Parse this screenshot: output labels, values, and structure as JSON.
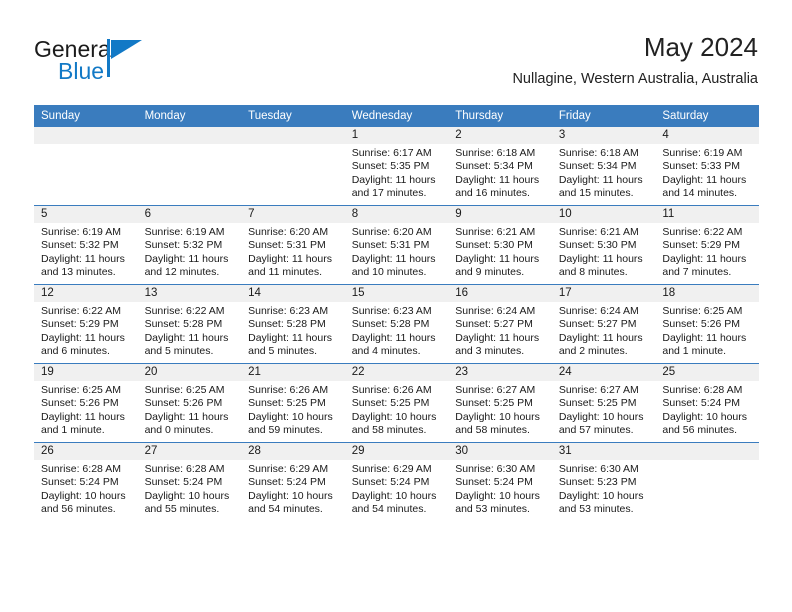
{
  "brand": {
    "name_top": "General",
    "name_bottom": "Blue",
    "accent_color": "#1279c6",
    "logo_icon": "triangle-flag-icon"
  },
  "header": {
    "title": "May 2024",
    "subtitle": "Nullagine, Western Australia, Australia"
  },
  "theme": {
    "header_bg": "#3a7cbe",
    "header_text": "#ffffff",
    "date_strip_bg": "#f0f0f0",
    "cell_bg": "#ffffff",
    "text": "#1a1a1a"
  },
  "calendar": {
    "columns": [
      "Sunday",
      "Monday",
      "Tuesday",
      "Wednesday",
      "Thursday",
      "Friday",
      "Saturday"
    ],
    "weeks": [
      [
        {
          "day": "",
          "lines": []
        },
        {
          "day": "",
          "lines": []
        },
        {
          "day": "",
          "lines": []
        },
        {
          "day": "1",
          "lines": [
            "Sunrise: 6:17 AM",
            "Sunset: 5:35 PM",
            "Daylight: 11 hours",
            "and 17 minutes."
          ]
        },
        {
          "day": "2",
          "lines": [
            "Sunrise: 6:18 AM",
            "Sunset: 5:34 PM",
            "Daylight: 11 hours",
            "and 16 minutes."
          ]
        },
        {
          "day": "3",
          "lines": [
            "Sunrise: 6:18 AM",
            "Sunset: 5:34 PM",
            "Daylight: 11 hours",
            "and 15 minutes."
          ]
        },
        {
          "day": "4",
          "lines": [
            "Sunrise: 6:19 AM",
            "Sunset: 5:33 PM",
            "Daylight: 11 hours",
            "and 14 minutes."
          ]
        }
      ],
      [
        {
          "day": "5",
          "lines": [
            "Sunrise: 6:19 AM",
            "Sunset: 5:32 PM",
            "Daylight: 11 hours",
            "and 13 minutes."
          ]
        },
        {
          "day": "6",
          "lines": [
            "Sunrise: 6:19 AM",
            "Sunset: 5:32 PM",
            "Daylight: 11 hours",
            "and 12 minutes."
          ]
        },
        {
          "day": "7",
          "lines": [
            "Sunrise: 6:20 AM",
            "Sunset: 5:31 PM",
            "Daylight: 11 hours",
            "and 11 minutes."
          ]
        },
        {
          "day": "8",
          "lines": [
            "Sunrise: 6:20 AM",
            "Sunset: 5:31 PM",
            "Daylight: 11 hours",
            "and 10 minutes."
          ]
        },
        {
          "day": "9",
          "lines": [
            "Sunrise: 6:21 AM",
            "Sunset: 5:30 PM",
            "Daylight: 11 hours",
            "and 9 minutes."
          ]
        },
        {
          "day": "10",
          "lines": [
            "Sunrise: 6:21 AM",
            "Sunset: 5:30 PM",
            "Daylight: 11 hours",
            "and 8 minutes."
          ]
        },
        {
          "day": "11",
          "lines": [
            "Sunrise: 6:22 AM",
            "Sunset: 5:29 PM",
            "Daylight: 11 hours",
            "and 7 minutes."
          ]
        }
      ],
      [
        {
          "day": "12",
          "lines": [
            "Sunrise: 6:22 AM",
            "Sunset: 5:29 PM",
            "Daylight: 11 hours",
            "and 6 minutes."
          ]
        },
        {
          "day": "13",
          "lines": [
            "Sunrise: 6:22 AM",
            "Sunset: 5:28 PM",
            "Daylight: 11 hours",
            "and 5 minutes."
          ]
        },
        {
          "day": "14",
          "lines": [
            "Sunrise: 6:23 AM",
            "Sunset: 5:28 PM",
            "Daylight: 11 hours",
            "and 5 minutes."
          ]
        },
        {
          "day": "15",
          "lines": [
            "Sunrise: 6:23 AM",
            "Sunset: 5:28 PM",
            "Daylight: 11 hours",
            "and 4 minutes."
          ]
        },
        {
          "day": "16",
          "lines": [
            "Sunrise: 6:24 AM",
            "Sunset: 5:27 PM",
            "Daylight: 11 hours",
            "and 3 minutes."
          ]
        },
        {
          "day": "17",
          "lines": [
            "Sunrise: 6:24 AM",
            "Sunset: 5:27 PM",
            "Daylight: 11 hours",
            "and 2 minutes."
          ]
        },
        {
          "day": "18",
          "lines": [
            "Sunrise: 6:25 AM",
            "Sunset: 5:26 PM",
            "Daylight: 11 hours",
            "and 1 minute."
          ]
        }
      ],
      [
        {
          "day": "19",
          "lines": [
            "Sunrise: 6:25 AM",
            "Sunset: 5:26 PM",
            "Daylight: 11 hours",
            "and 1 minute."
          ]
        },
        {
          "day": "20",
          "lines": [
            "Sunrise: 6:25 AM",
            "Sunset: 5:26 PM",
            "Daylight: 11 hours",
            "and 0 minutes."
          ]
        },
        {
          "day": "21",
          "lines": [
            "Sunrise: 6:26 AM",
            "Sunset: 5:25 PM",
            "Daylight: 10 hours",
            "and 59 minutes."
          ]
        },
        {
          "day": "22",
          "lines": [
            "Sunrise: 6:26 AM",
            "Sunset: 5:25 PM",
            "Daylight: 10 hours",
            "and 58 minutes."
          ]
        },
        {
          "day": "23",
          "lines": [
            "Sunrise: 6:27 AM",
            "Sunset: 5:25 PM",
            "Daylight: 10 hours",
            "and 58 minutes."
          ]
        },
        {
          "day": "24",
          "lines": [
            "Sunrise: 6:27 AM",
            "Sunset: 5:25 PM",
            "Daylight: 10 hours",
            "and 57 minutes."
          ]
        },
        {
          "day": "25",
          "lines": [
            "Sunrise: 6:28 AM",
            "Sunset: 5:24 PM",
            "Daylight: 10 hours",
            "and 56 minutes."
          ]
        }
      ],
      [
        {
          "day": "26",
          "lines": [
            "Sunrise: 6:28 AM",
            "Sunset: 5:24 PM",
            "Daylight: 10 hours",
            "and 56 minutes."
          ]
        },
        {
          "day": "27",
          "lines": [
            "Sunrise: 6:28 AM",
            "Sunset: 5:24 PM",
            "Daylight: 10 hours",
            "and 55 minutes."
          ]
        },
        {
          "day": "28",
          "lines": [
            "Sunrise: 6:29 AM",
            "Sunset: 5:24 PM",
            "Daylight: 10 hours",
            "and 54 minutes."
          ]
        },
        {
          "day": "29",
          "lines": [
            "Sunrise: 6:29 AM",
            "Sunset: 5:24 PM",
            "Daylight: 10 hours",
            "and 54 minutes."
          ]
        },
        {
          "day": "30",
          "lines": [
            "Sunrise: 6:30 AM",
            "Sunset: 5:24 PM",
            "Daylight: 10 hours",
            "and 53 minutes."
          ]
        },
        {
          "day": "31",
          "lines": [
            "Sunrise: 6:30 AM",
            "Sunset: 5:23 PM",
            "Daylight: 10 hours",
            "and 53 minutes."
          ]
        },
        {
          "day": "",
          "lines": []
        }
      ]
    ]
  }
}
